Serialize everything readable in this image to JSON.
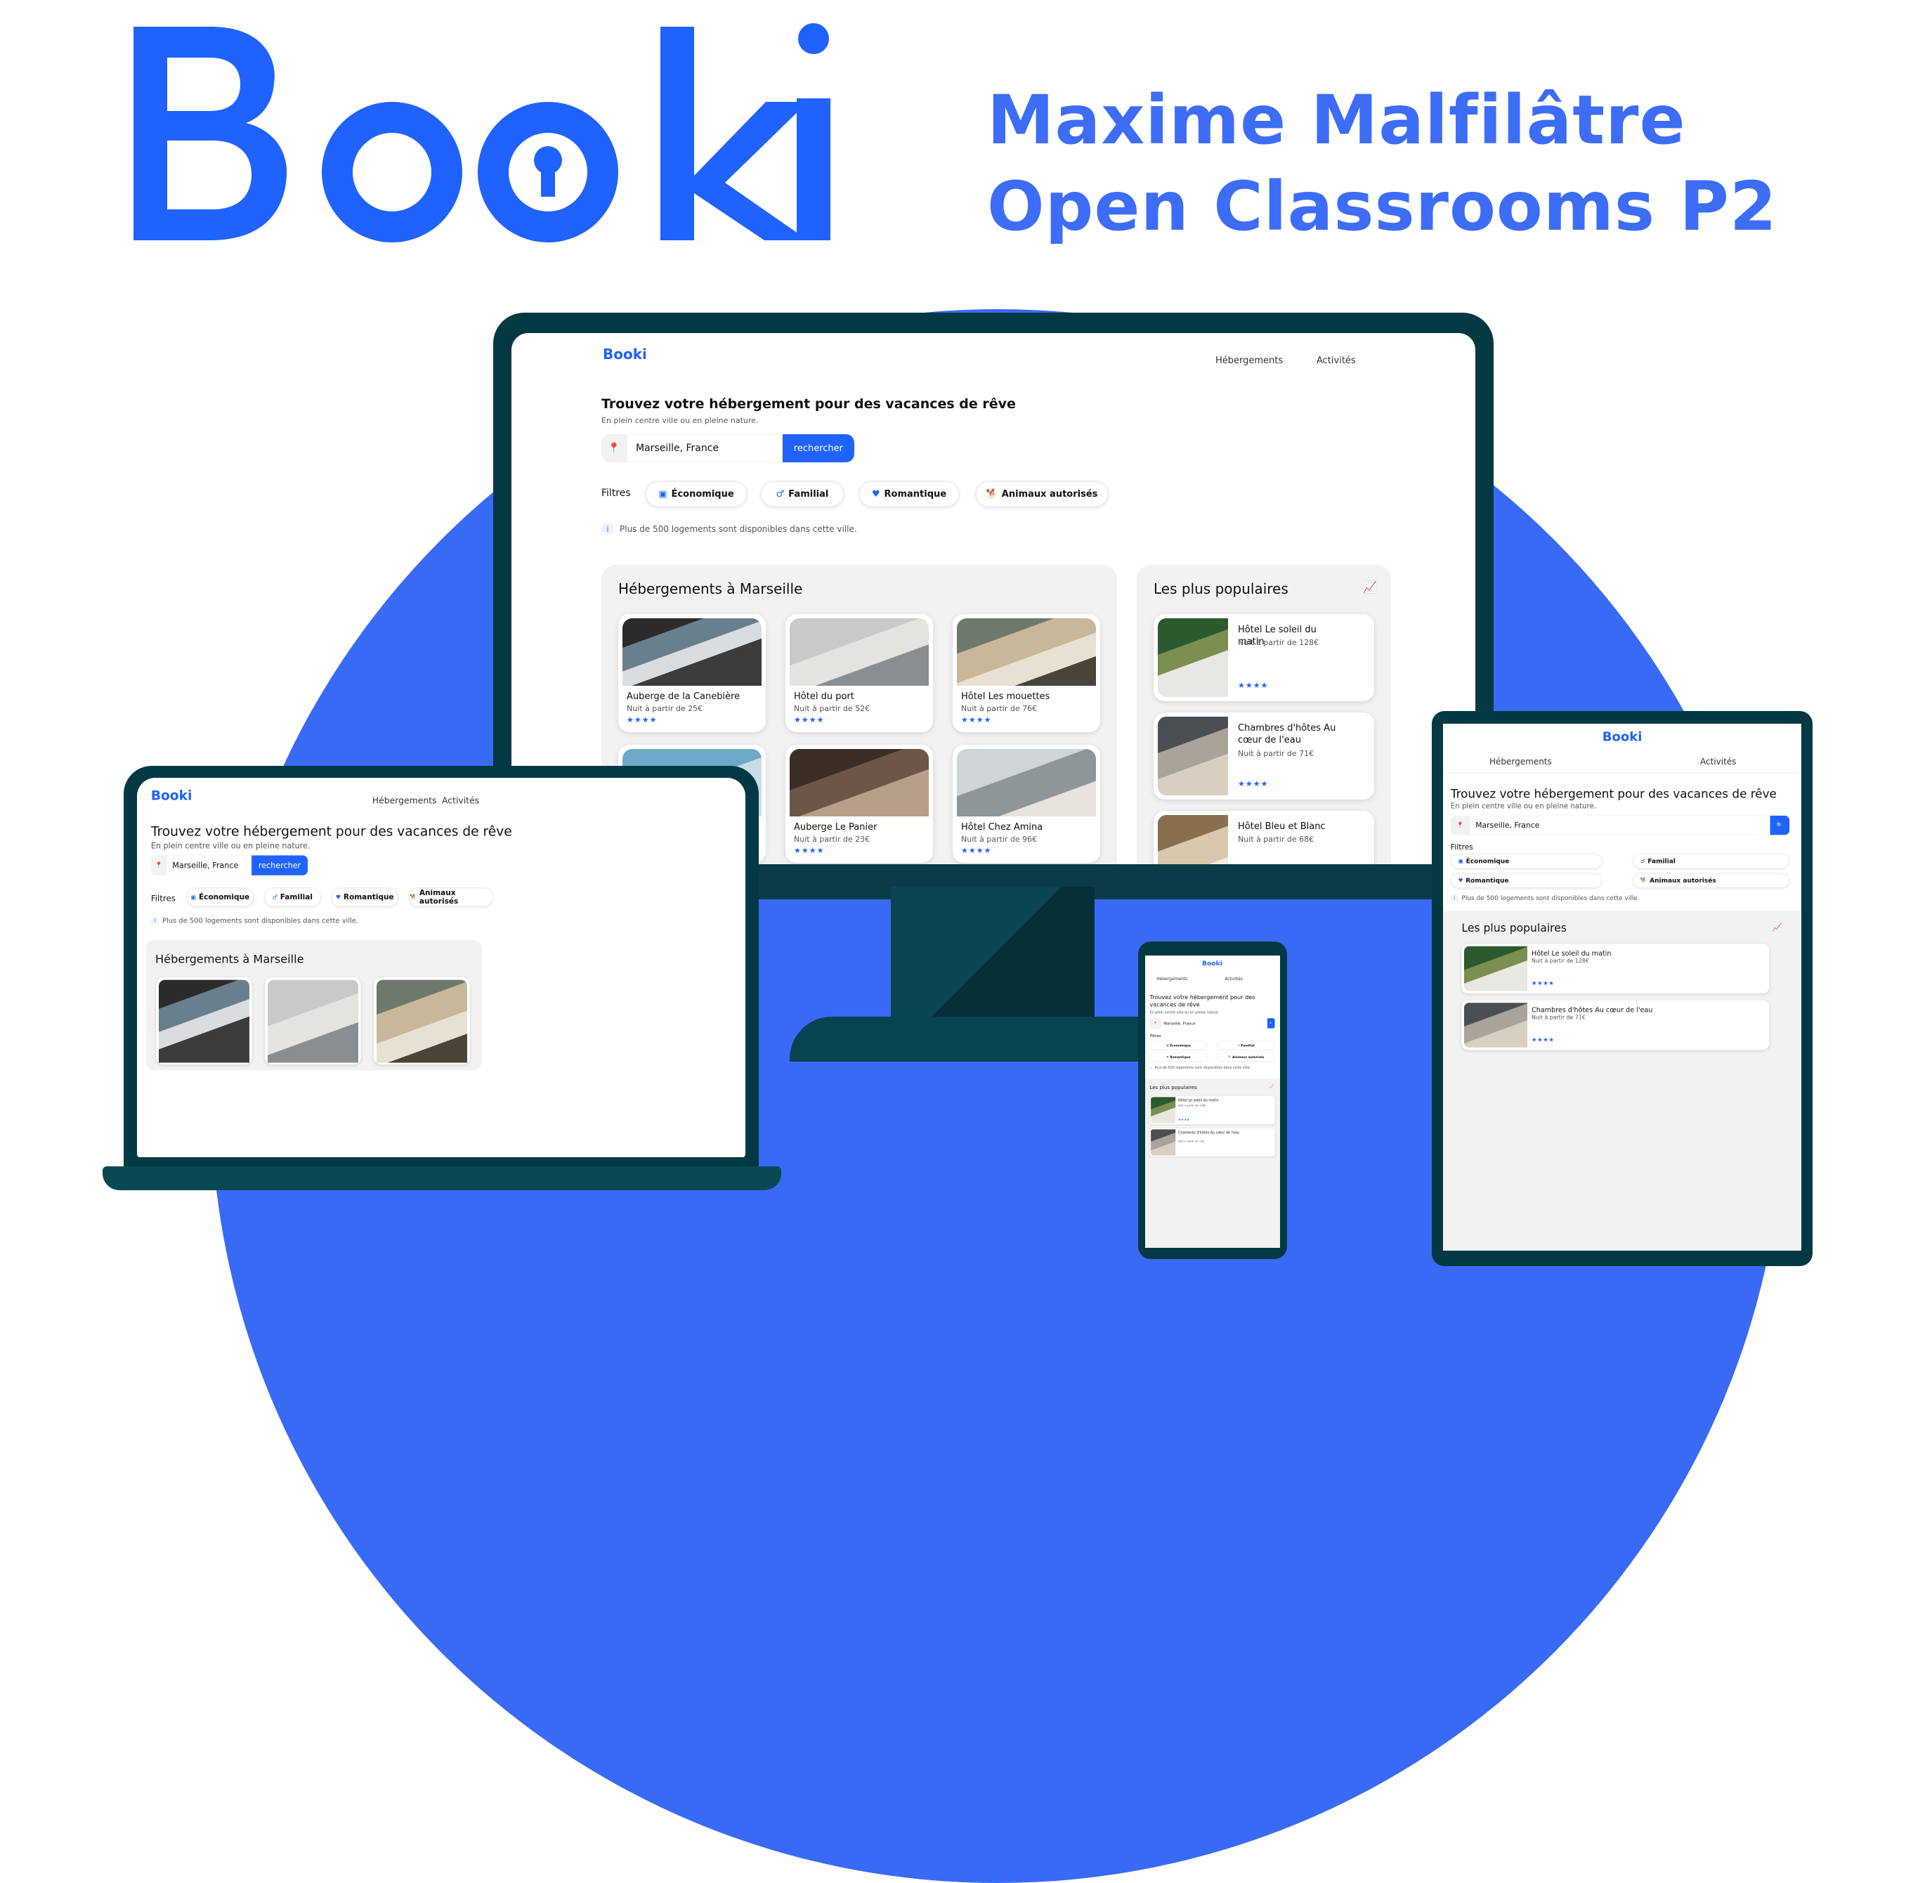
{
  "brand": {
    "logo_text": "Booki",
    "accent": "#1f62ff",
    "dark": "#043944"
  },
  "header": {
    "line1": "Maxime Malfilâtre",
    "line2": "Open Classrooms  P2"
  },
  "site": {
    "logo": "Booki",
    "nav": [
      "Hébergements",
      "Activités"
    ],
    "heading": "Trouvez votre hébergement pour des vacances de rêve",
    "subheading": "En plein centre ville ou en pleine nature.",
    "search": {
      "value": "Marseille, France",
      "button": "rechercher",
      "icon": "location-pin-icon"
    },
    "filters_label": "Filtres",
    "filters": [
      {
        "label": "Économique",
        "icon": "money-icon"
      },
      {
        "label": "Familial",
        "icon": "family-icon"
      },
      {
        "label": "Romantique",
        "icon": "heart-icon"
      },
      {
        "label": "Animaux autorisés",
        "icon": "dog-icon"
      }
    ],
    "info": "Plus de 500 logements sont disponibles dans cette ville.",
    "accommodations_title": "Hébergements à Marseille",
    "accommodations": [
      {
        "name": "Auberge de la Canebière",
        "price": "Nuit à partir de 25€",
        "stars": "★★★★"
      },
      {
        "name": "Hôtel du port",
        "price": "Nuit à partir de 52€",
        "stars": "★★★★"
      },
      {
        "name": "Hôtel Les mouettes",
        "price": "Nuit à partir de 76€",
        "stars": "★★★★"
      },
      {
        "name": "",
        "price": "",
        "stars": ""
      },
      {
        "name": "Auberge Le Panier",
        "price": "Nuit à partir de 23€",
        "stars": "★★★★"
      },
      {
        "name": "Hôtel Chez Amina",
        "price": "Nuit à partir de 96€",
        "stars": "★★★★"
      }
    ],
    "popular_title": "Les plus populaires",
    "popular": [
      {
        "name": "Hôtel Le soleil du matin",
        "price": "Nuit à partir de 128€",
        "stars": "★★★★"
      },
      {
        "name": "Chambres d'hôtes Au cœur de l'eau",
        "price": "Nuit à partir de 71€",
        "stars": "★★★★"
      },
      {
        "name": "Hôtel Bleu et Blanc",
        "price": "Nuit à partir de 68€",
        "stars": ""
      }
    ]
  }
}
